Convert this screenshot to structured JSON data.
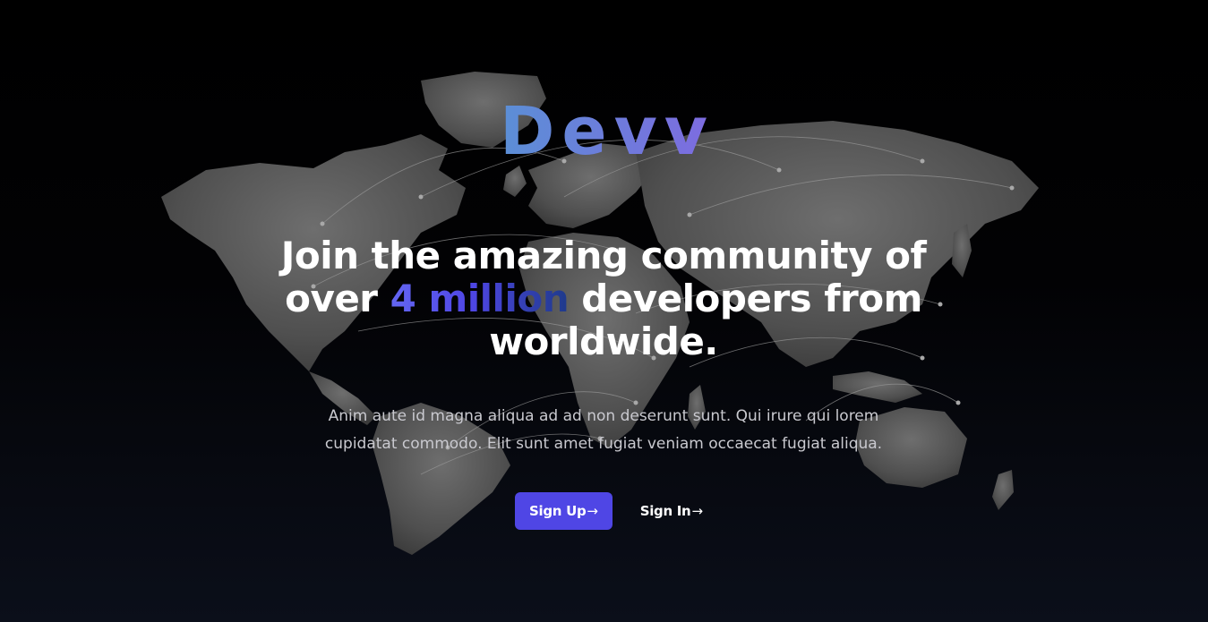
{
  "brand": {
    "logo_text": "Devv",
    "gradient_start": "#5b8fd6",
    "gradient_end": "#7e6be0"
  },
  "hero": {
    "headline_part1": "Join the amazing community of over ",
    "headline_accent": "4 million",
    "headline_part2": " developers from worldwide.",
    "description": "Anim aute id magna aliqua ad ad non deserunt sunt. Qui irure qui lorem cupidatat commodo. Elit sunt amet fugiat veniam occaecat fugiat aliqua."
  },
  "actions": {
    "signup_label": "Sign Up",
    "signin_label": "Sign In",
    "arrow_glyph": "→"
  },
  "colors": {
    "primary": "#4f46e5",
    "accent_text": "#6366f1",
    "map_land": "#5a5a5a",
    "background": "#000000"
  },
  "icons": {
    "background": "world-map-icon",
    "arrow": "arrow-right-icon"
  }
}
